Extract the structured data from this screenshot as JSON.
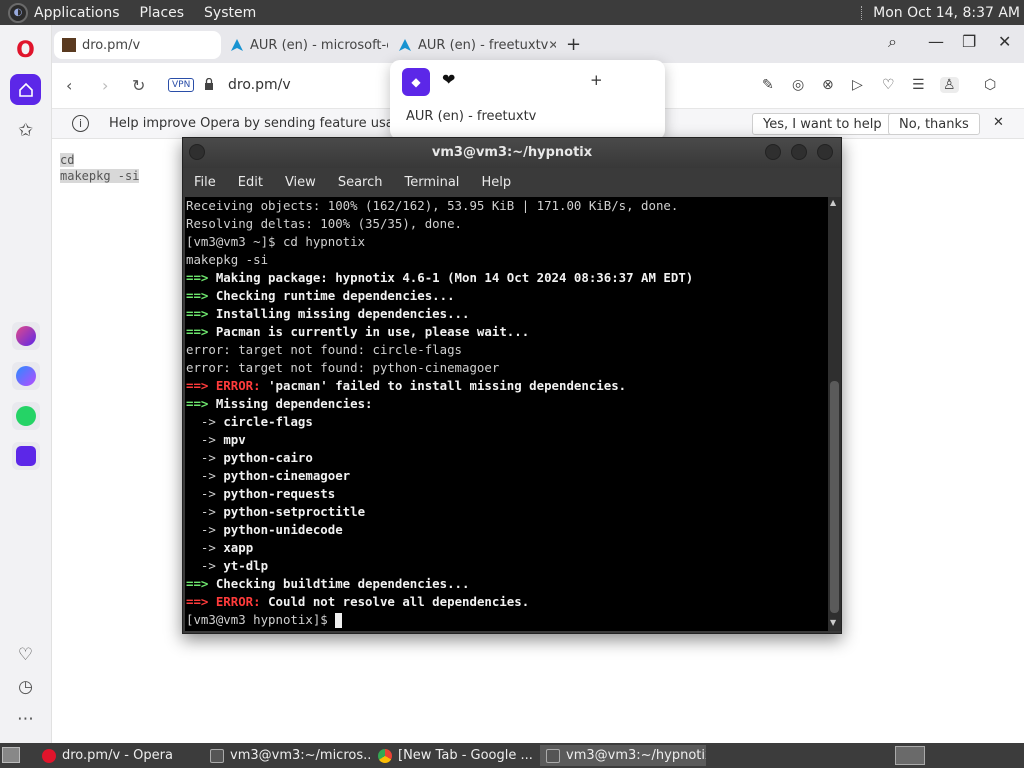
{
  "top_panel": {
    "menus": [
      "Applications",
      "Places",
      "System"
    ],
    "clock": "Mon Oct 14,  8:37 AM"
  },
  "browser": {
    "tabs": [
      {
        "title": "dro.pm/v",
        "active": true
      },
      {
        "title": "AUR (en) - microsoft-ed",
        "active": false
      },
      {
        "title": "AUR (en) - freetuxtv",
        "active": false
      }
    ],
    "address": {
      "vpn_label": "VPN",
      "url": "dro.pm/v"
    },
    "infobar": {
      "message": "Help improve Opera by sending feature usage inf",
      "accept_label": "Yes, I want to help",
      "decline_label": "No, thanks"
    },
    "page_lines": [
      "cd",
      "makepkg -si"
    ],
    "tab_popup": {
      "title": "AUR (en) - freetuxtv"
    }
  },
  "terminal": {
    "title": "vm3@vm3:~/hypnotix",
    "menu": [
      "File",
      "Edit",
      "View",
      "Search",
      "Terminal",
      "Help"
    ],
    "lines": [
      {
        "style": "plain",
        "text": "Receiving objects: 100% (162/162), 53.95 KiB | 171.00 KiB/s, done."
      },
      {
        "style": "plain",
        "text": "Resolving deltas: 100% (35/35), done."
      },
      {
        "style": "plain",
        "text": "[vm3@vm3 ~]$ cd hypnotix"
      },
      {
        "style": "plain",
        "text": "makepkg -si"
      },
      {
        "style": "green-arrow",
        "prefix": "==> ",
        "text": "Making package: hypnotix 4.6-1 (Mon 14 Oct 2024 08:36:37 AM EDT)"
      },
      {
        "style": "green-arrow",
        "prefix": "==> ",
        "text": "Checking runtime dependencies..."
      },
      {
        "style": "green-arrow",
        "prefix": "==> ",
        "text": "Installing missing dependencies..."
      },
      {
        "style": "green-arrow",
        "prefix": "==> ",
        "text": "Pacman is currently in use, please wait..."
      },
      {
        "style": "plain",
        "text": "error: target not found: circle-flags"
      },
      {
        "style": "plain",
        "text": "error: target not found: python-cinemagoer"
      },
      {
        "style": "error",
        "prefix": "==> ",
        "label": "ERROR:",
        "text": " 'pacman' failed to install missing dependencies."
      },
      {
        "style": "green-arrow",
        "prefix": "==> ",
        "text": "Missing dependencies:"
      },
      {
        "style": "dep",
        "prefix": "  -> ",
        "text": "circle-flags"
      },
      {
        "style": "dep",
        "prefix": "  -> ",
        "text": "mpv"
      },
      {
        "style": "dep",
        "prefix": "  -> ",
        "text": "python-cairo"
      },
      {
        "style": "dep",
        "prefix": "  -> ",
        "text": "python-cinemagoer"
      },
      {
        "style": "dep",
        "prefix": "  -> ",
        "text": "python-requests"
      },
      {
        "style": "dep",
        "prefix": "  -> ",
        "text": "python-setproctitle"
      },
      {
        "style": "dep",
        "prefix": "  -> ",
        "text": "python-unidecode"
      },
      {
        "style": "dep",
        "prefix": "  -> ",
        "text": "xapp"
      },
      {
        "style": "dep",
        "prefix": "  -> ",
        "text": "yt-dlp"
      },
      {
        "style": "green-arrow",
        "prefix": "==> ",
        "text": "Checking buildtime dependencies..."
      },
      {
        "style": "error",
        "prefix": "==> ",
        "label": "ERROR:",
        "text": " Could not resolve all dependencies."
      },
      {
        "style": "prompt",
        "text": "[vm3@vm3 hypnotix]$ "
      }
    ]
  },
  "taskbar": {
    "tasks": [
      {
        "title": "dro.pm/v - Opera",
        "active": false
      },
      {
        "title": "vm3@vm3:~/micros...",
        "active": false
      },
      {
        "title": "[New Tab - Google ...",
        "active": false
      },
      {
        "title": "vm3@vm3:~/hypnotix",
        "active": true
      }
    ]
  },
  "colors": {
    "opera_red": "#e0142b",
    "opera_purple": "#5c27e8",
    "terminal_green": "#6ee66e",
    "terminal_red": "#ff3b3b",
    "panel_bg": "#3c3c3c"
  },
  "icons": {
    "sidebar": [
      "opera-logo-icon",
      "home-icon",
      "cube-icon",
      "aria-icon",
      "messenger-icon",
      "whatsapp-icon",
      "music-icon",
      "heart-icon",
      "history-icon",
      "more-icon"
    ],
    "toolbar": [
      "edit-icon",
      "camera-icon",
      "shield-icon",
      "play-icon",
      "heart-icon",
      "menu-icon",
      "profile-icon",
      "box-icon"
    ]
  }
}
